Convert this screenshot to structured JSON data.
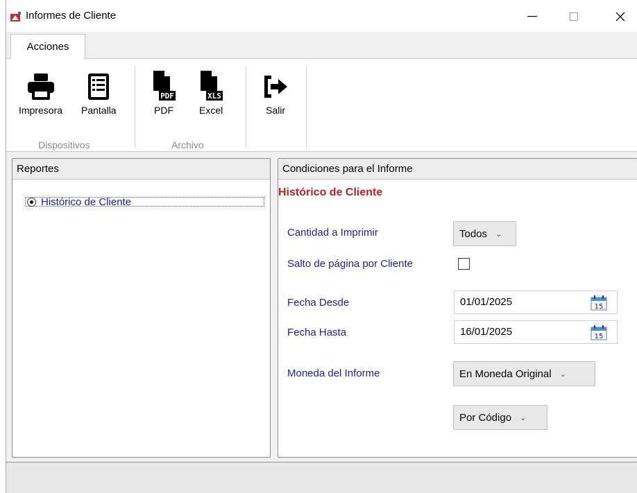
{
  "window": {
    "title": "Informes de Cliente",
    "controls": {
      "minimize": "—",
      "maximize": "☐",
      "close": "✕"
    }
  },
  "ribbon": {
    "tab_label": "Acciones",
    "buttons": {
      "printer": {
        "label": "Impresora",
        "icon": "printer-icon"
      },
      "screen": {
        "label": "Pantalla",
        "icon": "document-list-icon"
      },
      "pdf": {
        "label": "PDF",
        "icon": "pdf-file-icon",
        "badge": "PDF"
      },
      "excel": {
        "label": "Excel",
        "icon": "xls-file-icon",
        "badge": "XLS"
      },
      "exit": {
        "label": "Salir",
        "icon": "exit-icon"
      }
    },
    "groups": {
      "devices": "Dispositivos",
      "file": "Archivo"
    }
  },
  "left_panel": {
    "header": "Reportes",
    "items": [
      {
        "label": "Histórico de Cliente",
        "selected": true
      }
    ]
  },
  "right_panel": {
    "header": "Condiciones para el Informe",
    "report_title": "Histórico de Cliente",
    "fields": {
      "cantidad": {
        "label": "Cantidad a Imprimir",
        "value": "Todos"
      },
      "salto": {
        "label": "Salto de página por Cliente",
        "checked": false
      },
      "desde": {
        "label": "Fecha Desde",
        "value": "01/01/2025",
        "cal_day": "15"
      },
      "hasta": {
        "label": "Fecha Hasta",
        "value": "16/01/2025",
        "cal_day": "15"
      },
      "moneda": {
        "label": "Moneda del Informe",
        "value": "En Moneda Original"
      },
      "orden": {
        "value": "Por Código"
      }
    }
  },
  "colors": {
    "report_title": "#b22222",
    "field_label": "#1f1f8a",
    "link": "#1a1a9e"
  }
}
